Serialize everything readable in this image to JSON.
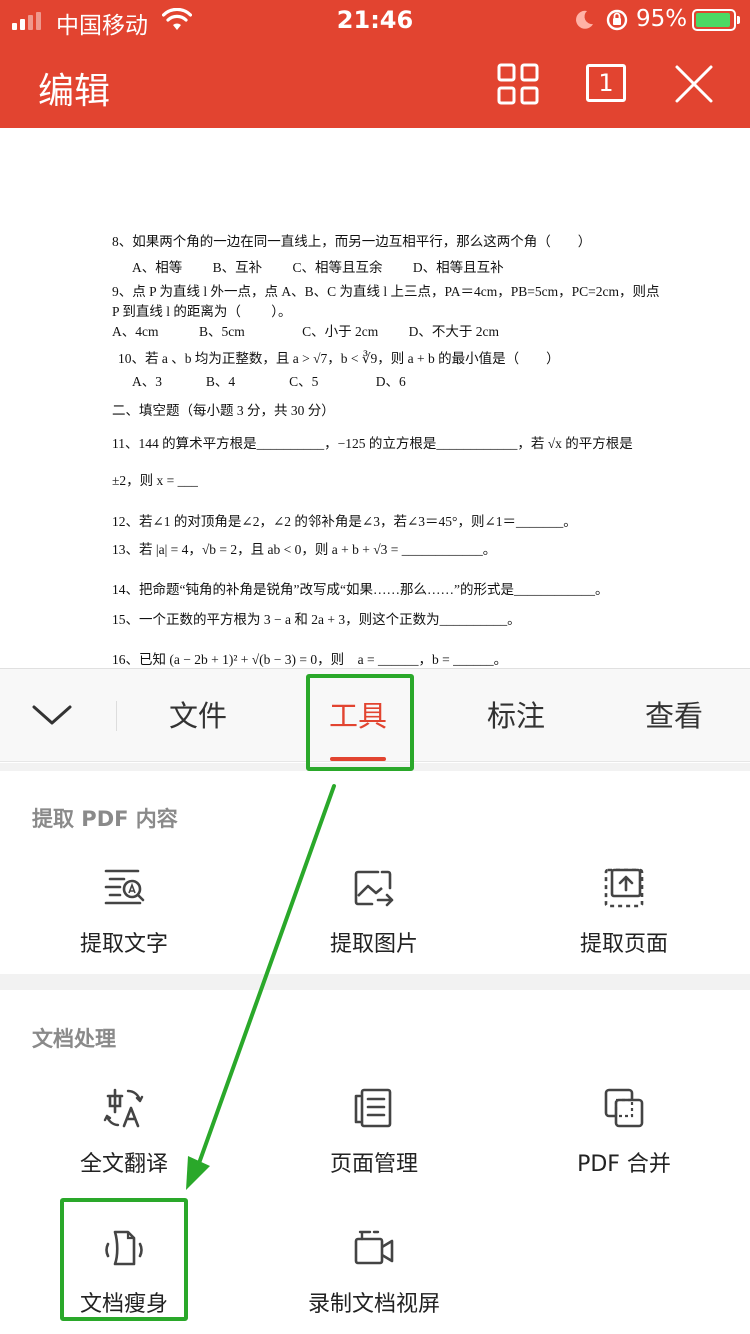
{
  "status_bar": {
    "carrier": "中国移动",
    "time": "21:46",
    "battery_percent": "95%",
    "battery_level": 0.95
  },
  "header": {
    "title": "编辑",
    "page_count": "1",
    "icons": [
      "grid-icon",
      "page-number-icon",
      "close-icon"
    ]
  },
  "document": {
    "lines": [
      "8、如果两个角的一边在同一直线上，而另一边互相平行，那么这两个角（　　）",
      "A、相等　　 B、互补　　 C、相等且互余　　 D、相等且互补",
      "9、点 P 为直线 l 外一点，点 A、B、C 为直线 l 上三点，PA＝4cm，PB=5cm，PC=2cm，则点",
      "P 到直线 l 的距离为（　　 ）。",
      "A、4cm　　　B、5cm　　　　 C、小于 2cm　　 D、不大于 2cm",
      "10、若 a 、b 均为正整数，且 a > √7，b < ∛9，则 a + b 的最小值是（　　）",
      "A、3　　　 B、4　　　　C、5　　　　 D、6",
      "二、填空题（每小题 3 分，共 30 分）",
      "11、144 的算术平方根是__________，−125 的立方根是____________，若 √x 的平方根是",
      "±2，则 x = ___",
      "12、若∠1 的对顶角是∠2，∠2 的邻补角是∠3，若∠3＝45°，则∠1＝_______。",
      "13、若 |a| = 4，√b = 2，且 ab < 0，则 a + b + √3 = ____________。",
      "14、把命题“钝角的补角是锐角”改写成“如果……那么……”的形式是____________。",
      "15、一个正数的平方根为 3 − a 和 2a + 3，则这个正数为__________。",
      "16、已知 (a − 2b + 1)² + √(b − 3) = 0，则　a = ______，b = ______。"
    ]
  },
  "tabs": [
    {
      "label": "文件",
      "active": false
    },
    {
      "label": "工具",
      "active": true
    },
    {
      "label": "标注",
      "active": false
    },
    {
      "label": "查看",
      "active": false
    }
  ],
  "sections": [
    {
      "title": "提取 PDF 内容",
      "tools": [
        {
          "label": "提取文字",
          "icon": "extract-text-icon"
        },
        {
          "label": "提取图片",
          "icon": "extract-image-icon"
        },
        {
          "label": "提取页面",
          "icon": "extract-page-icon"
        }
      ]
    },
    {
      "title": "文档处理",
      "tools": [
        {
          "label": "全文翻译",
          "icon": "translate-icon"
        },
        {
          "label": "页面管理",
          "icon": "page-manage-icon"
        },
        {
          "label": "PDF 合并",
          "icon": "pdf-merge-icon"
        },
        {
          "label": "文档瘦身",
          "icon": "slim-document-icon"
        },
        {
          "label": "录制文档视屏",
          "icon": "record-screen-icon"
        }
      ]
    }
  ],
  "colors": {
    "brand": "#e24430",
    "highlight": "#2aa82a",
    "icon": "#444444"
  }
}
